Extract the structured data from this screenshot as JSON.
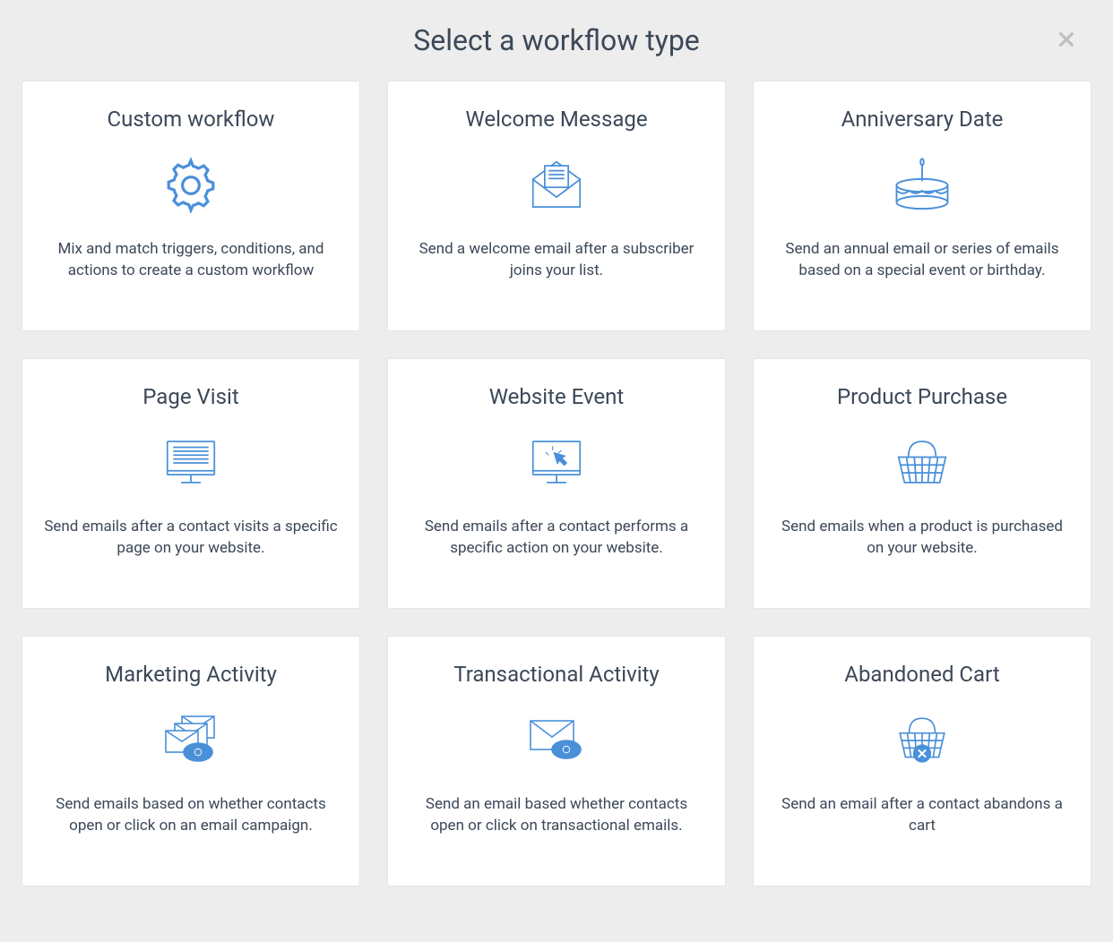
{
  "header": {
    "title": "Select a workflow type"
  },
  "cards": [
    {
      "id": "custom-workflow",
      "title": "Custom workflow",
      "icon": "gear-icon",
      "desc": "Mix and match triggers, conditions, and actions to create a custom workflow"
    },
    {
      "id": "welcome-message",
      "title": "Welcome Message",
      "icon": "envelope-letter-icon",
      "desc": "Send a welcome email after a subscriber joins your list."
    },
    {
      "id": "anniversary-date",
      "title": "Anniversary Date",
      "icon": "cake-icon",
      "desc": "Send an annual email or series of emails based on a special event or birthday."
    },
    {
      "id": "page-visit",
      "title": "Page Visit",
      "icon": "monitor-text-icon",
      "desc": "Send emails after a contact visits a specific page on your website."
    },
    {
      "id": "website-event",
      "title": "Website Event",
      "icon": "monitor-cursor-icon",
      "desc": "Send emails after a contact performs a specific action on your website."
    },
    {
      "id": "product-purchase",
      "title": "Product Purchase",
      "icon": "basket-icon",
      "desc": "Send emails when a product is purchased on your website."
    },
    {
      "id": "marketing-activity",
      "title": "Marketing Activity",
      "icon": "envelopes-eye-icon",
      "desc": "Send emails based on whether contacts open or click on an email campaign."
    },
    {
      "id": "transactional-activity",
      "title": "Transactional Activity",
      "icon": "envelope-eye-icon",
      "desc": "Send an email based whether contacts open or click on transactional emails."
    },
    {
      "id": "abandoned-cart",
      "title": "Abandoned Cart",
      "icon": "basket-x-icon",
      "desc": "Send an email after a contact abandons a cart"
    }
  ]
}
